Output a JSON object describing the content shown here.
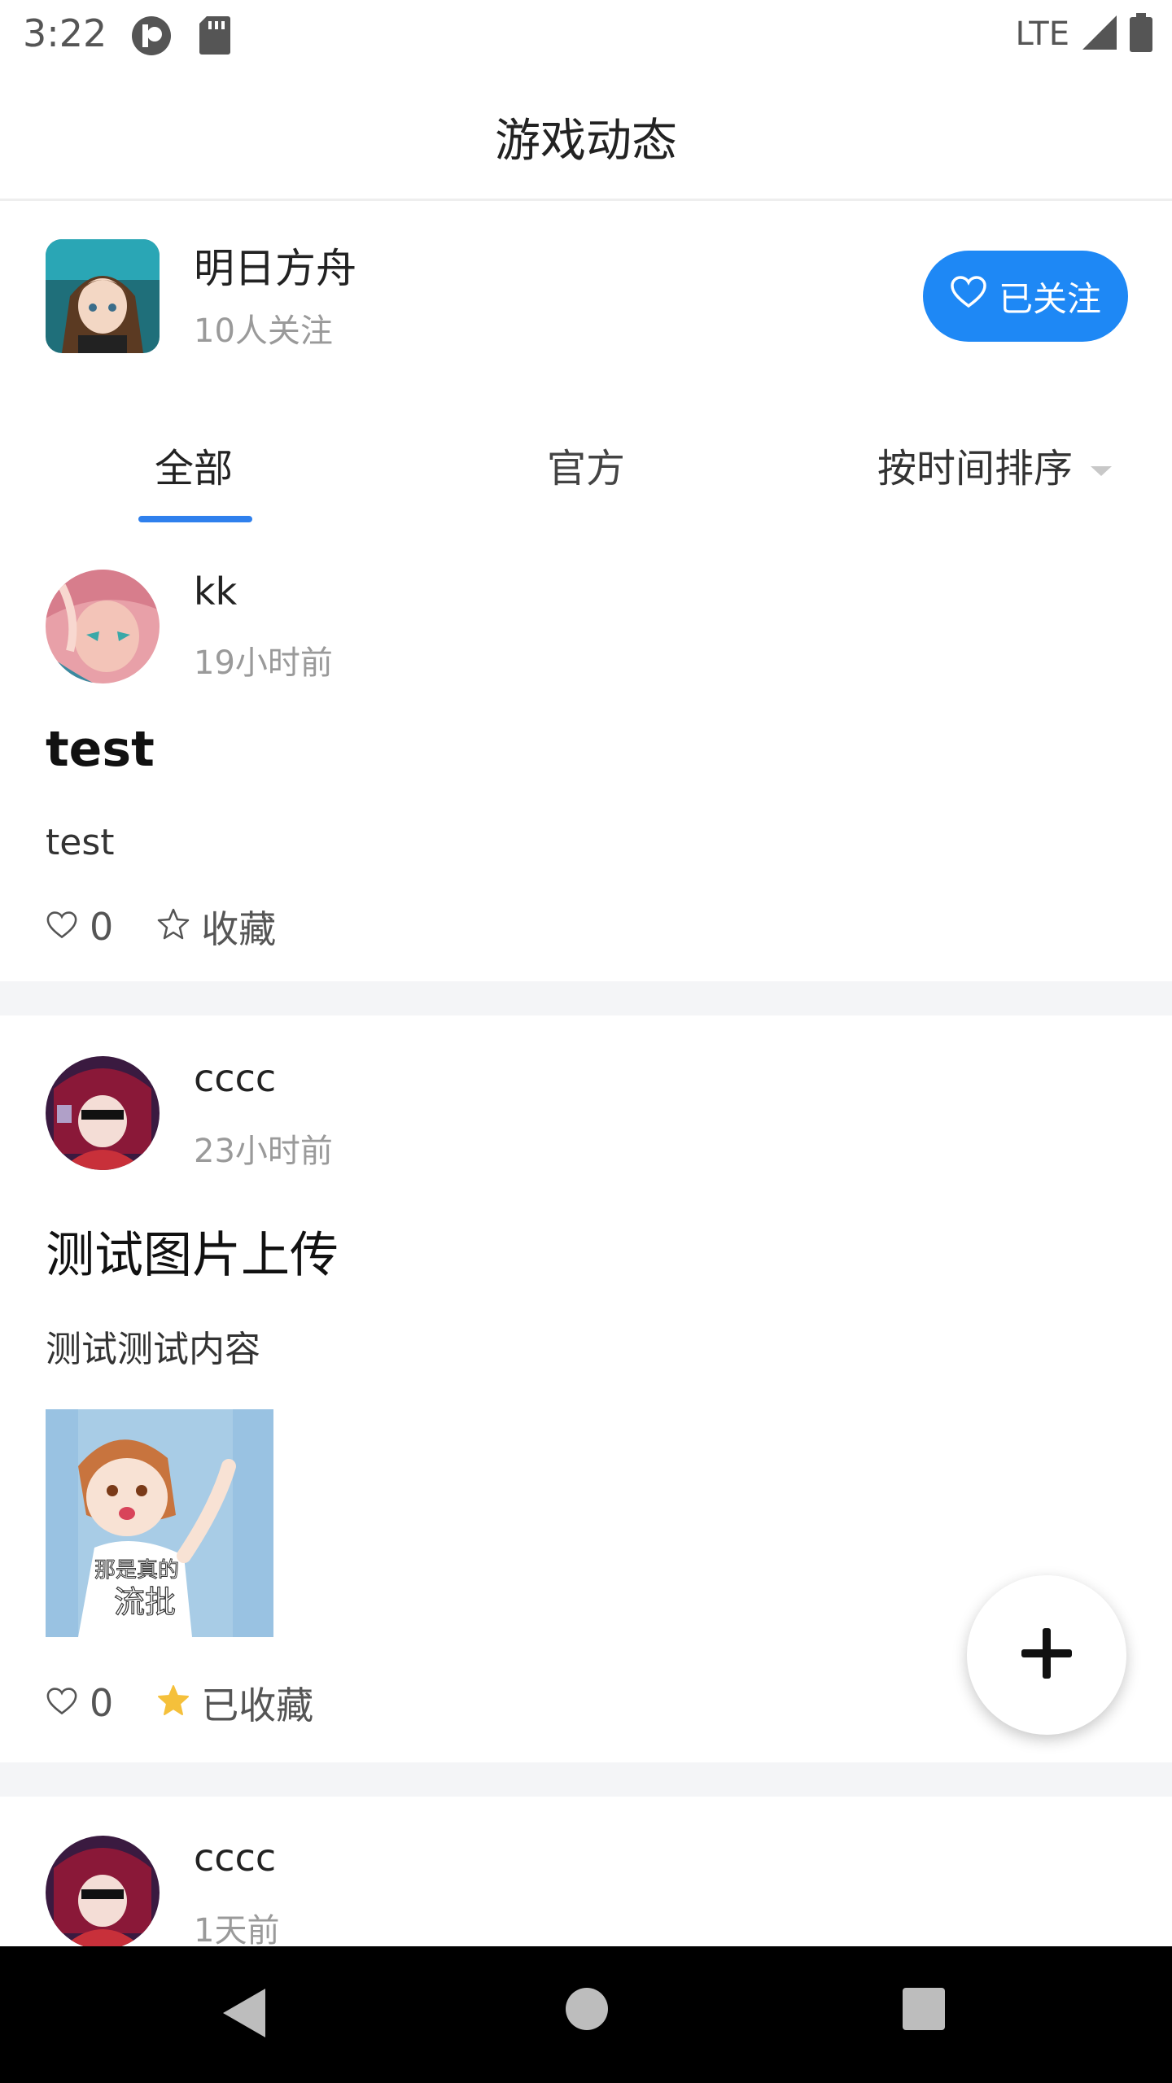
{
  "status_bar": {
    "time": "3:22",
    "network": "LTE"
  },
  "header": {
    "title": "游戏动态"
  },
  "game": {
    "name": "明日方舟",
    "followers": "10人关注",
    "follow_label": "已关注"
  },
  "tabs": [
    {
      "label": "全部",
      "active": true
    },
    {
      "label": "官方",
      "active": false
    }
  ],
  "sort": {
    "label": "按时间排序"
  },
  "posts": [
    {
      "author": "kk",
      "time": "19小时前",
      "title": "test",
      "body": "test",
      "likes": "0",
      "favorite_label": "收藏",
      "favorited": false
    },
    {
      "author": "cccc",
      "time": "23小时前",
      "title": "测试图片上传",
      "body": "测试测试内容",
      "image_caption_line1": "那是真的",
      "image_caption_line2": "流批",
      "likes": "0",
      "favorite_label": "已收藏",
      "favorited": true
    },
    {
      "author": "cccc",
      "time": "1天前"
    }
  ],
  "colors": {
    "accent": "#1e88f5",
    "tab_underline": "#2f80ed",
    "star_active": "#f5c03b",
    "divider": "#f4f5f7"
  }
}
